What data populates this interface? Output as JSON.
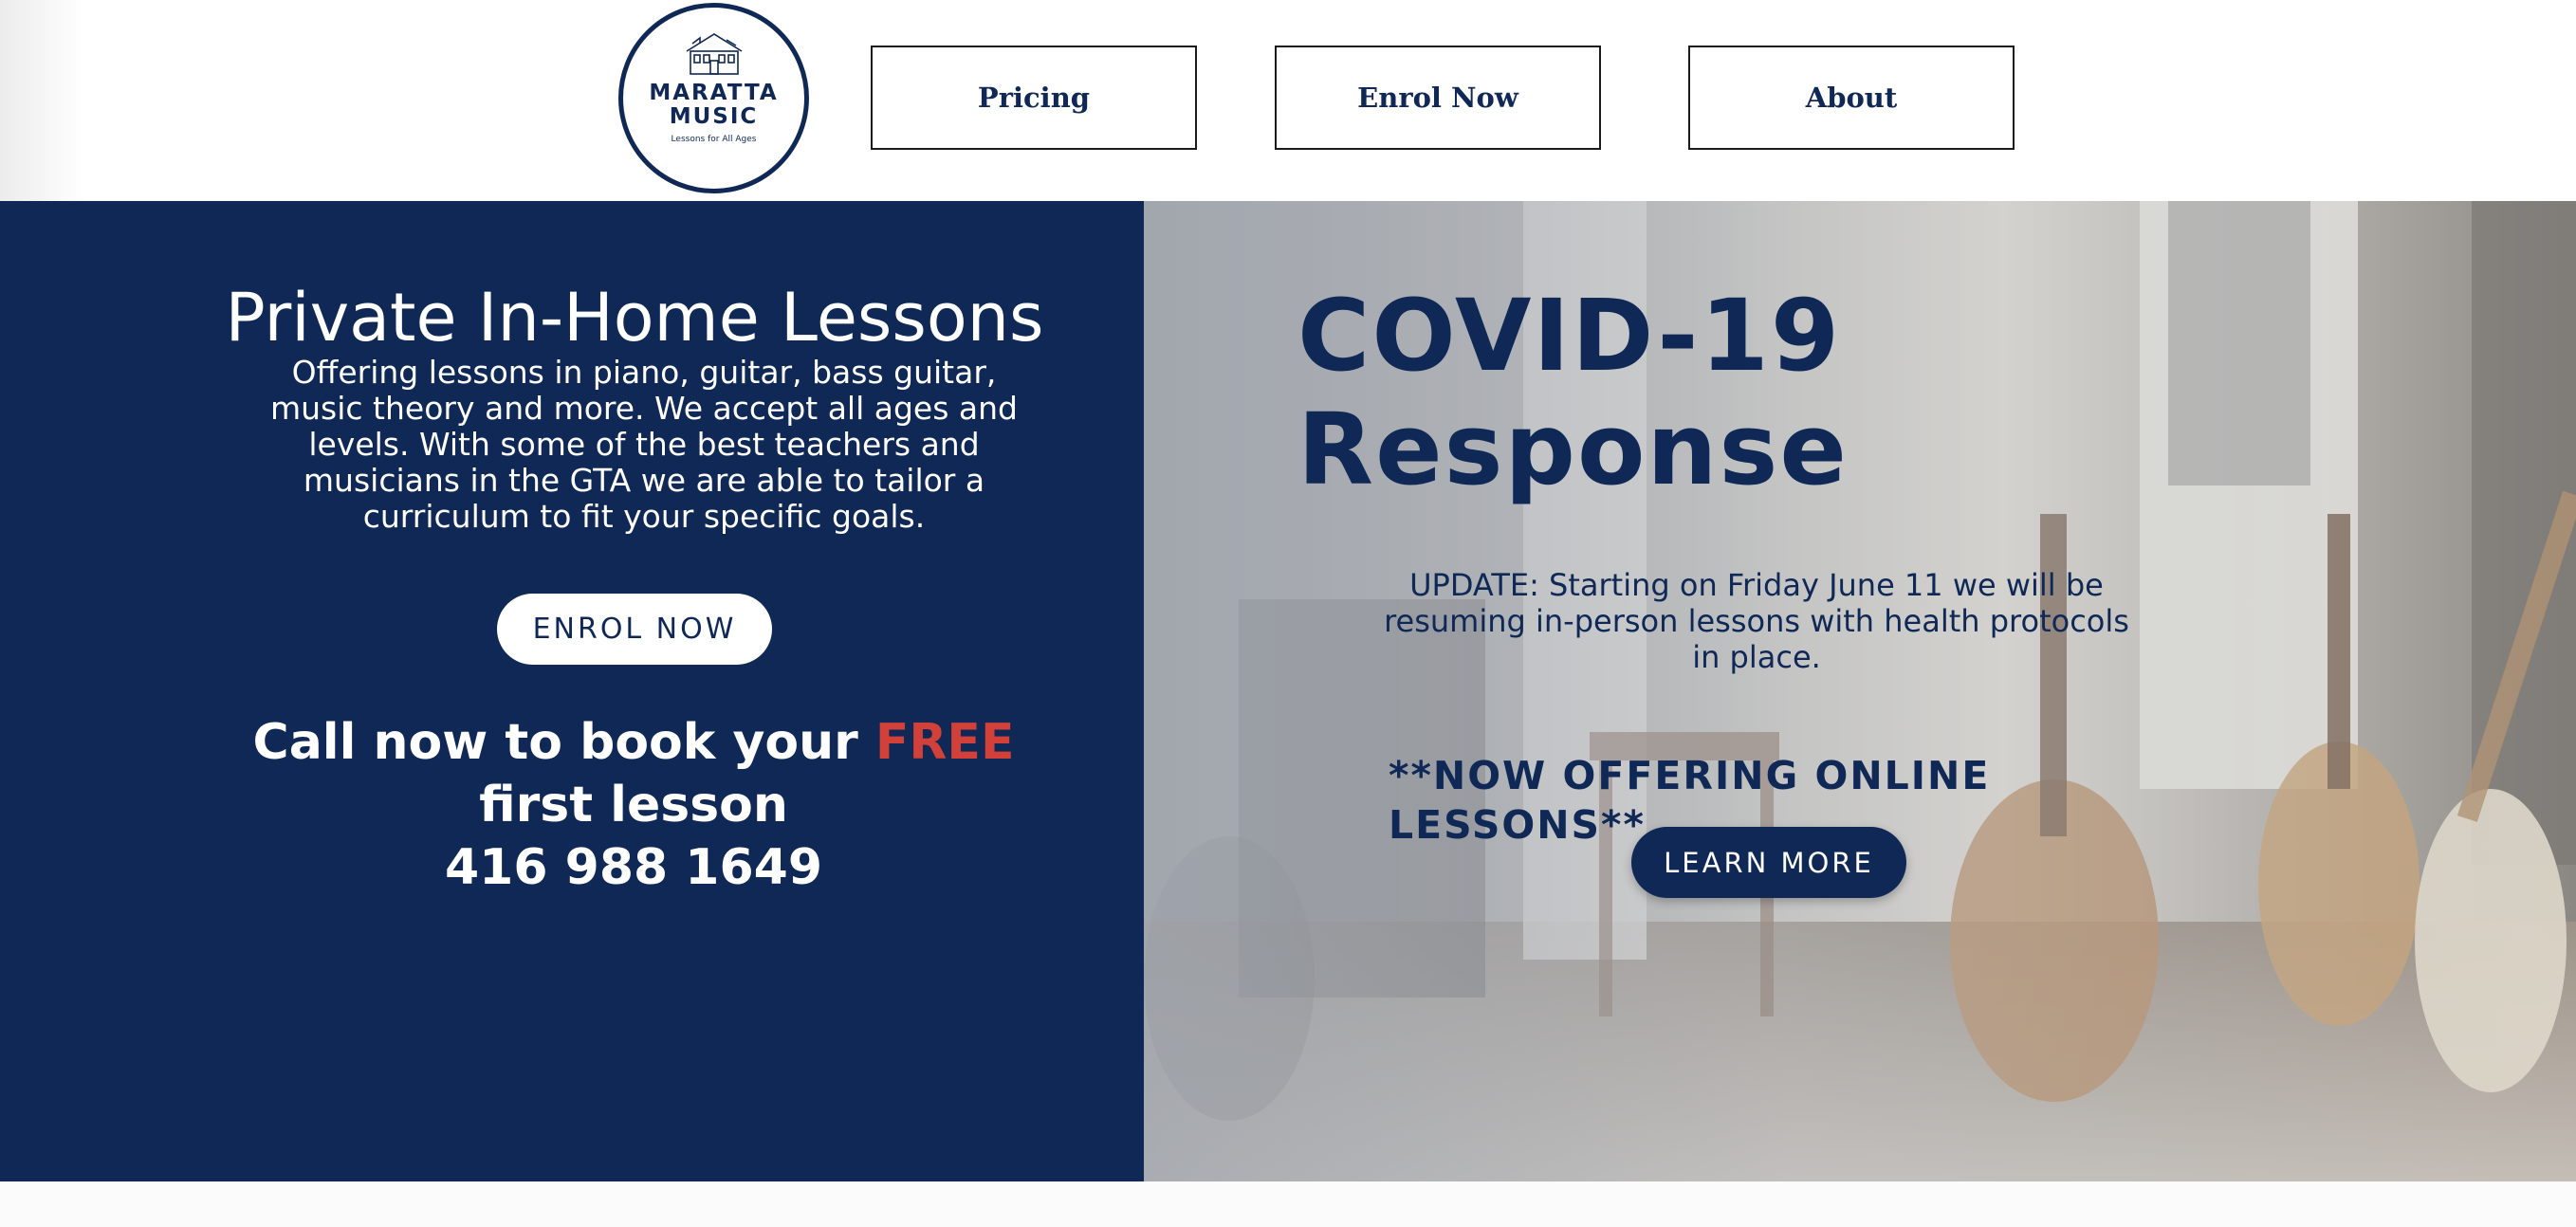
{
  "header": {
    "logo": {
      "title": "MARATTA MUSIC",
      "tagline": "Lessons for All Ages"
    },
    "nav": {
      "pricing": "Pricing",
      "enrol": "Enrol Now",
      "about": "About"
    }
  },
  "hero_left": {
    "title": "Private In-Home Lessons",
    "description": "Offering lessons in piano, guitar, bass guitar, music theory and more. We accept all ages and levels. With some of the best teachers and musicians in the GTA we are able to tailor a curriculum to fit your specific goals.",
    "cta_label": "ENROL NOW",
    "call_prefix": "Call now to book your ",
    "call_highlight": "FREE",
    "call_suffix": " first lesson",
    "phone": "416 988 1649"
  },
  "hero_right": {
    "title_line1": "COVID-19",
    "title_line2": "Response",
    "update": "UPDATE: Starting on Friday June 11 we will be resuming in-person lessons with health protocols in place.",
    "online": "**NOW OFFERING ONLINE LESSONS**",
    "learn_more_label": "LEARN MORE"
  },
  "colors": {
    "navy": "#0f2856",
    "accent_red": "#d2403a",
    "white": "#ffffff"
  }
}
